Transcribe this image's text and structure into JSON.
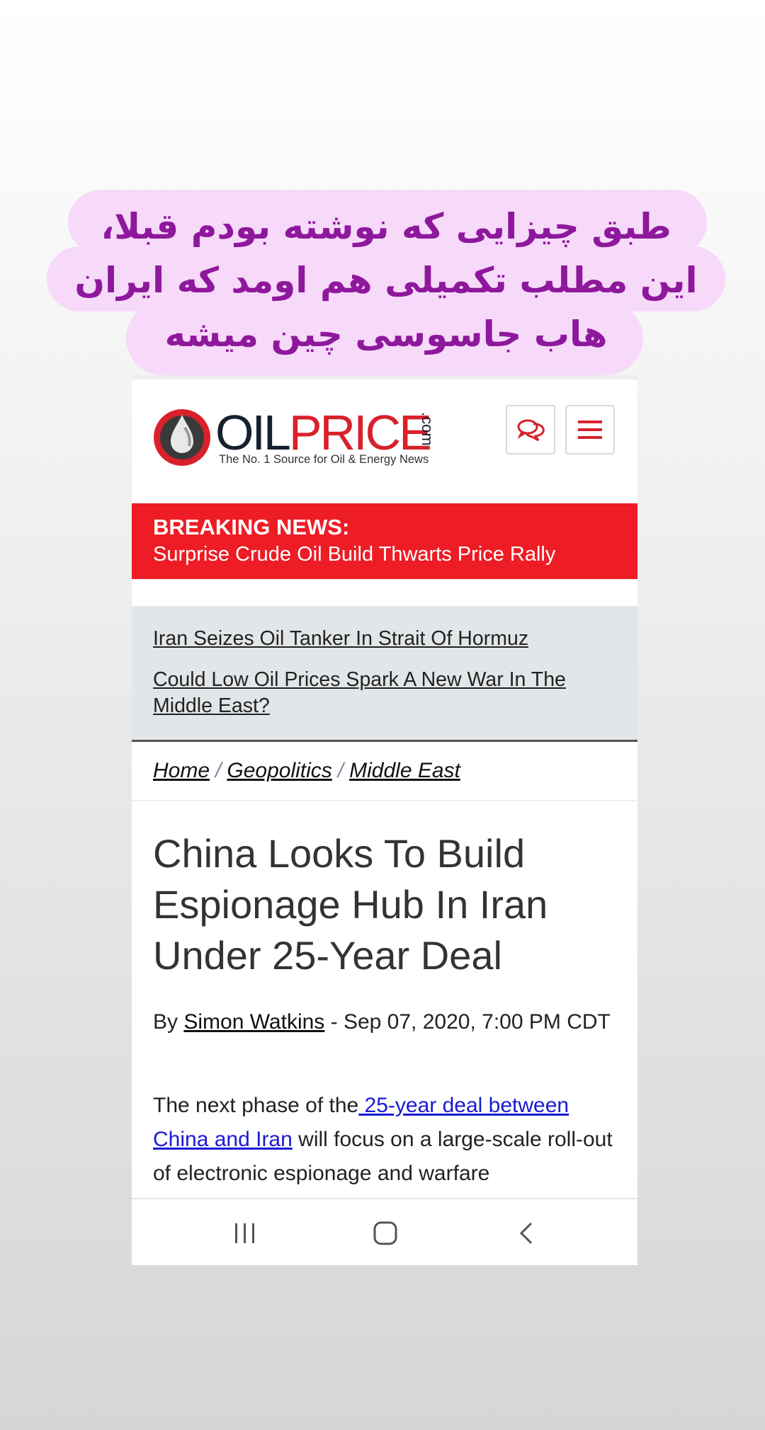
{
  "caption": {
    "lines": [
      "طبق چیزایی که نوشته بودم قبلا،",
      "این مطلب تکمیلی هم اومد که ایران",
      "هاب جاسوسی چین میشه"
    ]
  },
  "site": {
    "logo_oil": "OIL",
    "logo_price": "PRICE",
    "logo_com": ".com",
    "tagline": "The No. 1 Source for Oil & Energy News"
  },
  "breaking": {
    "label": "BREAKING NEWS:",
    "text": "Surprise Crude Oil Build Thwarts Price Rally"
  },
  "headlines": [
    "Iran Seizes Oil Tanker In Strait Of Hormuz",
    "Could Low Oil Prices Spark A New War In The Middle East?"
  ],
  "breadcrumb": {
    "items": [
      "Home",
      "Geopolitics",
      "Middle East"
    ],
    "separator": "/"
  },
  "article": {
    "title": "China Looks To Build Espionage Hub In Iran Under 25-Year Deal",
    "by": "By ",
    "author": "Simon Watkins",
    "date": " - Sep 07, 2020, 7:00 PM CDT",
    "body_start": "The next phase of the",
    "body_link": " 25-year deal between China and Iran",
    "body_rest": " will focus on a large-scale roll-out of electronic espionage and warfare"
  },
  "icons": {
    "chat": "chat-bubbles-icon",
    "menu": "hamburger-menu-icon",
    "logo": "oil-drop-logo-icon",
    "recent": "recent-apps-icon",
    "home": "home-icon",
    "back": "back-chevron-icon"
  },
  "colors": {
    "brand_red": "#ee1c25",
    "caption_bg": "#f7d9fa",
    "caption_text": "#8e189c",
    "link_blue": "#1a1ad6"
  }
}
